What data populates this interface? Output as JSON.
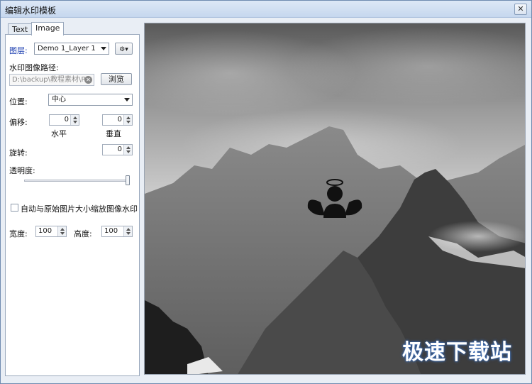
{
  "window": {
    "title": "编辑水印模板",
    "close_glyph": "✕"
  },
  "tabs": [
    {
      "label": "Text"
    },
    {
      "label": "Image"
    }
  ],
  "layer": {
    "label": "图层:",
    "selected": "Demo 1_Layer 1",
    "settings_glyph": "⚙▾"
  },
  "image_path": {
    "label": "水印图像路径:",
    "value": "D:\\backup\\教程素材\\PI",
    "clear_glyph": "✕",
    "browse_label": "浏览"
  },
  "position": {
    "label": "位置:",
    "selected": "中心"
  },
  "offset": {
    "label": "偏移:",
    "horizontal_value": "0",
    "horizontal_label": "水平",
    "vertical_value": "0",
    "vertical_label": "垂直"
  },
  "rotation": {
    "label": "旋转:",
    "value": "0"
  },
  "opacity": {
    "label": "透明度:",
    "level": 1.0
  },
  "auto_scale": {
    "label": "自动与原始图片大小缩放图像水印",
    "checked": false
  },
  "size": {
    "width_label": "宽度:",
    "width_value": "100",
    "height_label": "高度:",
    "height_value": "100"
  },
  "preview": {
    "corner_watermark": "极速下载站",
    "watermark_icon": "angel-user-icon"
  }
}
